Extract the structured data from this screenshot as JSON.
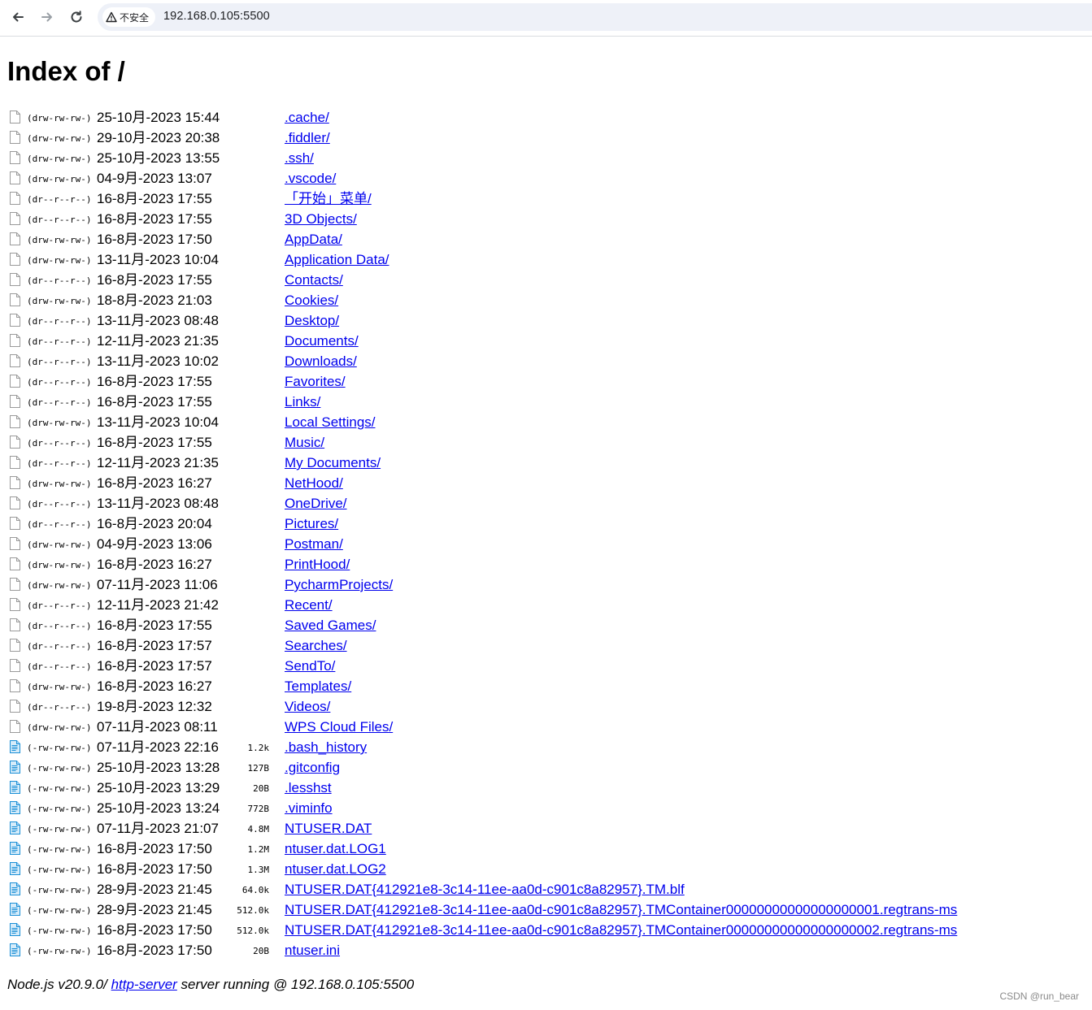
{
  "browser": {
    "security_label": "不安全",
    "url": "192.168.0.105:5500"
  },
  "page": {
    "title": "Index of /"
  },
  "entries": [
    {
      "type": "dir",
      "perms": "(drw-rw-rw-)",
      "date": "25-10月-2023 15:44",
      "size": "",
      "name": ".cache/"
    },
    {
      "type": "dir",
      "perms": "(drw-rw-rw-)",
      "date": "29-10月-2023 20:38",
      "size": "",
      "name": ".fiddler/"
    },
    {
      "type": "dir",
      "perms": "(drw-rw-rw-)",
      "date": "25-10月-2023 13:55",
      "size": "",
      "name": ".ssh/"
    },
    {
      "type": "dir",
      "perms": "(drw-rw-rw-)",
      "date": "04-9月-2023 13:07",
      "size": "",
      "name": ".vscode/"
    },
    {
      "type": "dir",
      "perms": "(dr--r--r--)",
      "date": "16-8月-2023 17:55",
      "size": "",
      "name": "「开始」菜单/"
    },
    {
      "type": "dir",
      "perms": "(dr--r--r--)",
      "date": "16-8月-2023 17:55",
      "size": "",
      "name": "3D Objects/"
    },
    {
      "type": "dir",
      "perms": "(drw-rw-rw-)",
      "date": "16-8月-2023 17:50",
      "size": "",
      "name": "AppData/"
    },
    {
      "type": "dir",
      "perms": "(drw-rw-rw-)",
      "date": "13-11月-2023 10:04",
      "size": "",
      "name": "Application Data/"
    },
    {
      "type": "dir",
      "perms": "(dr--r--r--)",
      "date": "16-8月-2023 17:55",
      "size": "",
      "name": "Contacts/"
    },
    {
      "type": "dir",
      "perms": "(drw-rw-rw-)",
      "date": "18-8月-2023 21:03",
      "size": "",
      "name": "Cookies/"
    },
    {
      "type": "dir",
      "perms": "(dr--r--r--)",
      "date": "13-11月-2023 08:48",
      "size": "",
      "name": "Desktop/"
    },
    {
      "type": "dir",
      "perms": "(dr--r--r--)",
      "date": "12-11月-2023 21:35",
      "size": "",
      "name": "Documents/"
    },
    {
      "type": "dir",
      "perms": "(dr--r--r--)",
      "date": "13-11月-2023 10:02",
      "size": "",
      "name": "Downloads/"
    },
    {
      "type": "dir",
      "perms": "(dr--r--r--)",
      "date": "16-8月-2023 17:55",
      "size": "",
      "name": "Favorites/"
    },
    {
      "type": "dir",
      "perms": "(dr--r--r--)",
      "date": "16-8月-2023 17:55",
      "size": "",
      "name": "Links/"
    },
    {
      "type": "dir",
      "perms": "(drw-rw-rw-)",
      "date": "13-11月-2023 10:04",
      "size": "",
      "name": "Local Settings/"
    },
    {
      "type": "dir",
      "perms": "(dr--r--r--)",
      "date": "16-8月-2023 17:55",
      "size": "",
      "name": "Music/"
    },
    {
      "type": "dir",
      "perms": "(dr--r--r--)",
      "date": "12-11月-2023 21:35",
      "size": "",
      "name": "My Documents/"
    },
    {
      "type": "dir",
      "perms": "(drw-rw-rw-)",
      "date": "16-8月-2023 16:27",
      "size": "",
      "name": "NetHood/"
    },
    {
      "type": "dir",
      "perms": "(dr--r--r--)",
      "date": "13-11月-2023 08:48",
      "size": "",
      "name": "OneDrive/"
    },
    {
      "type": "dir",
      "perms": "(dr--r--r--)",
      "date": "16-8月-2023 20:04",
      "size": "",
      "name": "Pictures/"
    },
    {
      "type": "dir",
      "perms": "(drw-rw-rw-)",
      "date": "04-9月-2023 13:06",
      "size": "",
      "name": "Postman/"
    },
    {
      "type": "dir",
      "perms": "(drw-rw-rw-)",
      "date": "16-8月-2023 16:27",
      "size": "",
      "name": "PrintHood/"
    },
    {
      "type": "dir",
      "perms": "(drw-rw-rw-)",
      "date": "07-11月-2023 11:06",
      "size": "",
      "name": "PycharmProjects/"
    },
    {
      "type": "dir",
      "perms": "(dr--r--r--)",
      "date": "12-11月-2023 21:42",
      "size": "",
      "name": "Recent/"
    },
    {
      "type": "dir",
      "perms": "(dr--r--r--)",
      "date": "16-8月-2023 17:55",
      "size": "",
      "name": "Saved Games/"
    },
    {
      "type": "dir",
      "perms": "(dr--r--r--)",
      "date": "16-8月-2023 17:57",
      "size": "",
      "name": "Searches/"
    },
    {
      "type": "dir",
      "perms": "(dr--r--r--)",
      "date": "16-8月-2023 17:57",
      "size": "",
      "name": "SendTo/"
    },
    {
      "type": "dir",
      "perms": "(drw-rw-rw-)",
      "date": "16-8月-2023 16:27",
      "size": "",
      "name": "Templates/"
    },
    {
      "type": "dir",
      "perms": "(dr--r--r--)",
      "date": "19-8月-2023 12:32",
      "size": "",
      "name": "Videos/"
    },
    {
      "type": "dir",
      "perms": "(drw-rw-rw-)",
      "date": "07-11月-2023 08:11",
      "size": "",
      "name": "WPS Cloud Files/"
    },
    {
      "type": "file",
      "perms": "(-rw-rw-rw-)",
      "date": "07-11月-2023 22:16",
      "size": "1.2k",
      "name": ".bash_history"
    },
    {
      "type": "file",
      "perms": "(-rw-rw-rw-)",
      "date": "25-10月-2023 13:28",
      "size": "127B",
      "name": ".gitconfig"
    },
    {
      "type": "file",
      "perms": "(-rw-rw-rw-)",
      "date": "25-10月-2023 13:29",
      "size": "20B",
      "name": ".lesshst"
    },
    {
      "type": "file",
      "perms": "(-rw-rw-rw-)",
      "date": "25-10月-2023 13:24",
      "size": "772B",
      "name": ".viminfo"
    },
    {
      "type": "file",
      "perms": "(-rw-rw-rw-)",
      "date": "07-11月-2023 21:07",
      "size": "4.8M",
      "name": "NTUSER.DAT"
    },
    {
      "type": "file",
      "perms": "(-rw-rw-rw-)",
      "date": "16-8月-2023 17:50",
      "size": "1.2M",
      "name": "ntuser.dat.LOG1"
    },
    {
      "type": "file",
      "perms": "(-rw-rw-rw-)",
      "date": "16-8月-2023 17:50",
      "size": "1.3M",
      "name": "ntuser.dat.LOG2"
    },
    {
      "type": "file",
      "perms": "(-rw-rw-rw-)",
      "date": "28-9月-2023 21:45",
      "size": "64.0k",
      "name": "NTUSER.DAT{412921e8-3c14-11ee-aa0d-c901c8a82957}.TM.blf"
    },
    {
      "type": "file",
      "perms": "(-rw-rw-rw-)",
      "date": "28-9月-2023 21:45",
      "size": "512.0k",
      "name": "NTUSER.DAT{412921e8-3c14-11ee-aa0d-c901c8a82957}.TMContainer00000000000000000001.regtrans-ms"
    },
    {
      "type": "file",
      "perms": "(-rw-rw-rw-)",
      "date": "16-8月-2023 17:50",
      "size": "512.0k",
      "name": "NTUSER.DAT{412921e8-3c14-11ee-aa0d-c901c8a82957}.TMContainer00000000000000000002.regtrans-ms"
    },
    {
      "type": "file",
      "perms": "(-rw-rw-rw-)",
      "date": "16-8月-2023 17:50",
      "size": "20B",
      "name": "ntuser.ini"
    }
  ],
  "footer": {
    "prefix": "Node.js v20.9.0/ ",
    "link_text": "http-server",
    "suffix": " server running @ 192.168.0.105:5500"
  },
  "watermark": "CSDN @run_bear",
  "icons": {
    "dir": "blank-page-icon",
    "file": "text-file-icon"
  },
  "colors": {
    "link": "#0000ee",
    "omnibox_bg": "#eef1f8",
    "file_icon": "#1a8fd6"
  }
}
